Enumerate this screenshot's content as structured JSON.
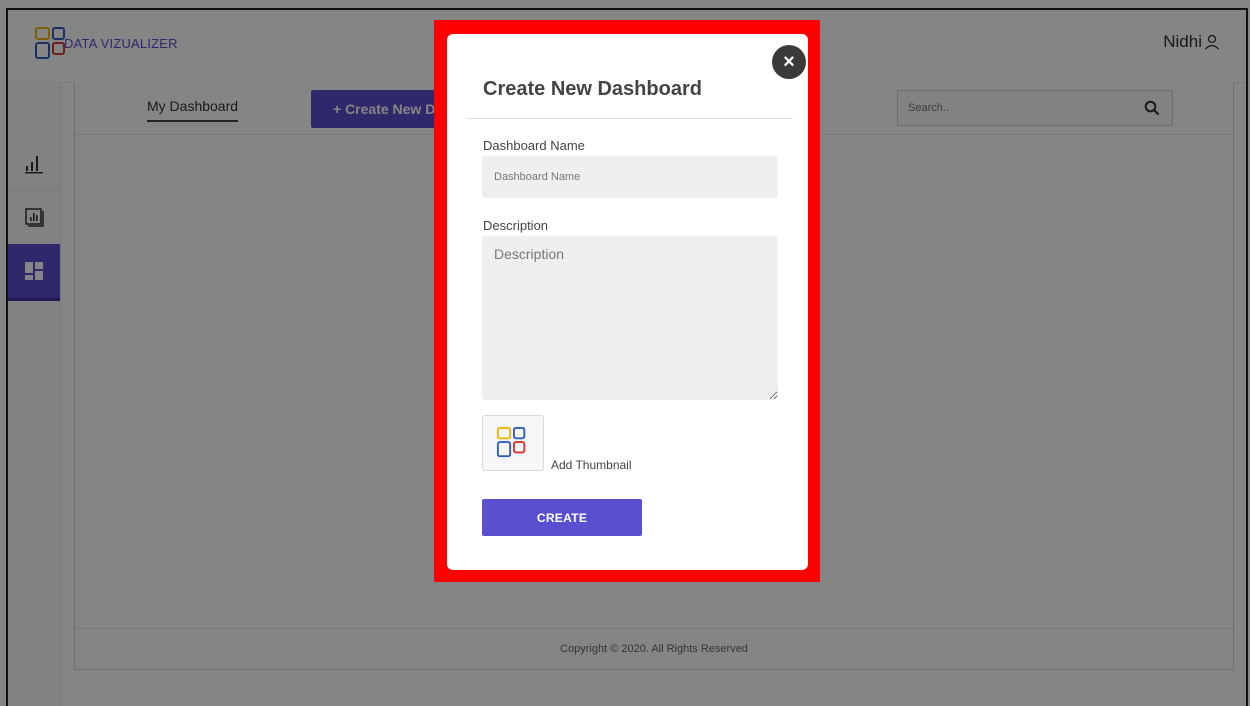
{
  "app": {
    "brand": "DATA VIZUALIZER"
  },
  "header": {
    "user_name": "Nidhi",
    "user_icon": "user-icon"
  },
  "sidebar": {
    "items": [
      {
        "icon": "bar-chart-icon"
      },
      {
        "icon": "report-icon"
      },
      {
        "icon": "dashboard-grid-icon",
        "active": true
      }
    ]
  },
  "tabs": {
    "my_dashboard": "My Dashboard"
  },
  "toolbar": {
    "create_label": "+ Create New Dashboard"
  },
  "search": {
    "placeholder": "Search.."
  },
  "footer": {
    "copyright": "Copyright © 2020. All Rights Reserved"
  },
  "modal": {
    "title": "Create New Dashboard",
    "close_icon": "close-icon",
    "name_label": "Dashboard Name",
    "name_placeholder": "Dashboard Name",
    "desc_label": "Description",
    "desc_placeholder": "Description",
    "thumbnail_label": "Add Thumbnail",
    "submit_label": "CREATE"
  },
  "colors": {
    "accent": "#5a4fcf",
    "highlight": "#ff0000"
  }
}
